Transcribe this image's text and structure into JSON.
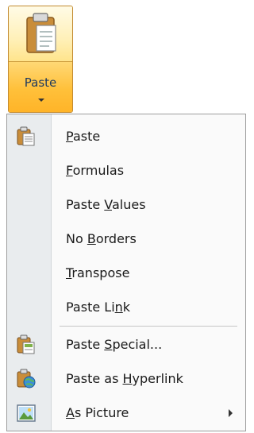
{
  "split_button": {
    "label": "Paste"
  },
  "menu": {
    "items": [
      {
        "pre": "",
        "key": "P",
        "post": "aste",
        "icon": "paste-icon"
      },
      {
        "pre": "",
        "key": "F",
        "post": "ormulas",
        "icon": ""
      },
      {
        "pre": "Paste ",
        "key": "V",
        "post": "alues",
        "icon": ""
      },
      {
        "pre": "No ",
        "key": "B",
        "post": "orders",
        "icon": ""
      },
      {
        "pre": "",
        "key": "T",
        "post": "ranspose",
        "icon": ""
      },
      {
        "pre": "Paste Li",
        "key": "n",
        "post": "k",
        "icon": ""
      },
      {
        "pre": "Paste ",
        "key": "S",
        "post": "pecial...",
        "icon": "paste-special-icon"
      },
      {
        "pre": "Paste as ",
        "key": "H",
        "post": "yperlink",
        "icon": "paste-hyperlink-icon"
      },
      {
        "pre": "",
        "key": "A",
        "post": "s Picture",
        "icon": "picture-icon",
        "submenu": true
      }
    ]
  },
  "colors": {
    "split_top": "#fff0b8",
    "split_bottom": "#ffc03a",
    "border": "#c28a30",
    "gutter": "#e9ecee"
  }
}
